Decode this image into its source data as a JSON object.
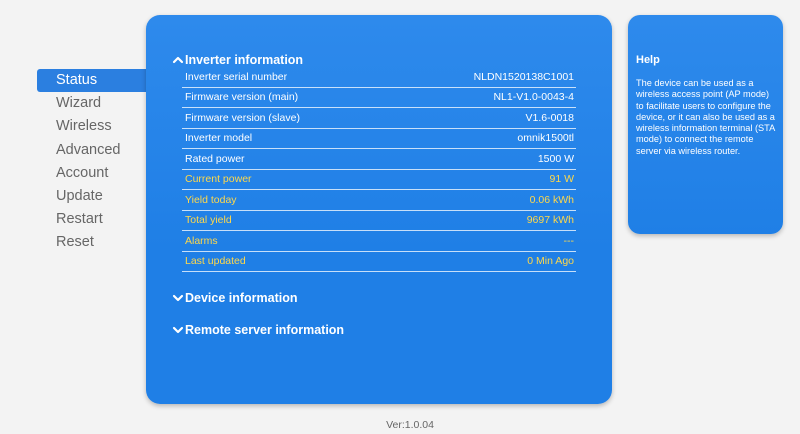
{
  "nav": {
    "items": [
      {
        "label": "Status",
        "active": true
      },
      {
        "label": "Wizard"
      },
      {
        "label": "Wireless"
      },
      {
        "label": "Advanced"
      },
      {
        "label": "Account"
      },
      {
        "label": "Update"
      },
      {
        "label": "Restart"
      },
      {
        "label": "Reset"
      }
    ]
  },
  "main": {
    "inverter_title": "Inverter information",
    "device_title": "Device information",
    "remote_title": "Remote server information",
    "rows": [
      {
        "label": "Inverter serial number",
        "value": "NLDN1520138C1001"
      },
      {
        "label": "Firmware version (main)",
        "value": "NL1-V1.0-0043-4"
      },
      {
        "label": "Firmware version (slave)",
        "value": "V1.6-0018"
      },
      {
        "label": "Inverter model",
        "value": "omnik1500tl"
      },
      {
        "label": "Rated power",
        "value": "1500 W"
      },
      {
        "label": "Current power",
        "value": "91 W"
      },
      {
        "label": "Yield today",
        "value": "0.06 kWh"
      },
      {
        "label": "Total yield",
        "value": "9697 kWh"
      },
      {
        "label": "Alarms",
        "value": "---"
      },
      {
        "label": "Last updated",
        "value": "0 Min Ago"
      }
    ]
  },
  "help": {
    "title": "Help",
    "text": "The device can be used as a wireless access point (AP mode) to facilitate users to configure the device, or it can also be used as a wireless information terminal (STA mode) to connect the remote server via wireless router."
  },
  "footer": {
    "version": "Ver:1.0.04"
  },
  "colors": {
    "panel": "#1f7fe6",
    "active_nav": "#2b7fe0",
    "highlight": "#ffd84a"
  },
  "icons": {
    "expanded": "chevron-up-icon",
    "collapsed": "chevron-down-icon"
  }
}
